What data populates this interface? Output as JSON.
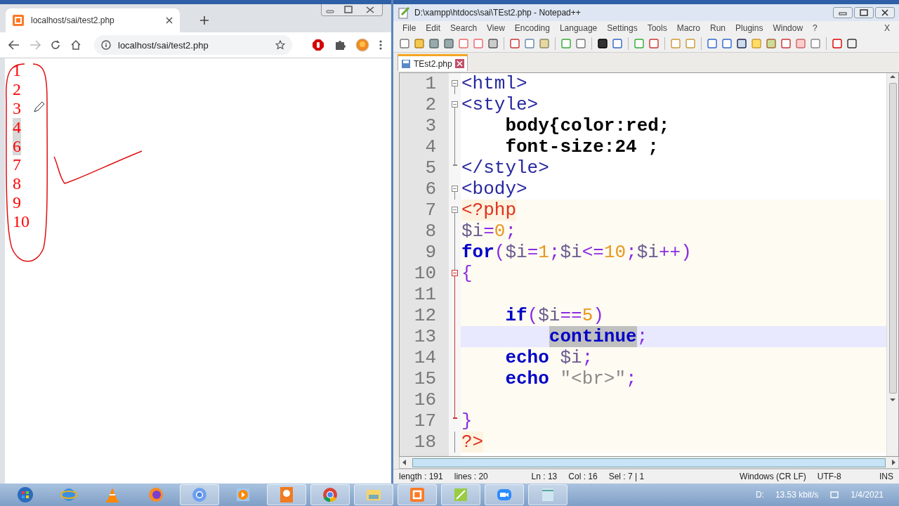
{
  "browser": {
    "tab": {
      "title": "localhost/sai/test2.php"
    },
    "address": "localhost/sai/test2.php",
    "page_lines": [
      {
        "text": "1",
        "selected": false
      },
      {
        "text": "2",
        "selected": false
      },
      {
        "text": "3",
        "selected": false
      },
      {
        "text": "4",
        "selected": true
      },
      {
        "text": "6",
        "selected": true
      },
      {
        "text": "7",
        "selected": false
      },
      {
        "text": "8",
        "selected": false
      },
      {
        "text": "9",
        "selected": false
      },
      {
        "text": "10",
        "selected": false
      }
    ]
  },
  "editor": {
    "title": "D:\\xampp\\htdocs\\sai\\TEst2.php - Notepad++",
    "menu": [
      "File",
      "Edit",
      "Search",
      "View",
      "Encoding",
      "Language",
      "Settings",
      "Tools",
      "Macro",
      "Run",
      "Plugins",
      "Window",
      "?"
    ],
    "menu_close": "X",
    "tab": {
      "label": "TEst2.php"
    },
    "lines": [
      {
        "number": "1",
        "kind": "start",
        "current": false,
        "embedded": false,
        "tokens": [
          {
            "kind": "tag",
            "text": "<html>"
          }
        ]
      },
      {
        "number": "2",
        "kind": "start",
        "current": false,
        "embedded": false,
        "tokens": [
          {
            "kind": "tag",
            "text": "<style>"
          }
        ]
      },
      {
        "number": "3",
        "kind": "line",
        "current": false,
        "embedded": false,
        "tokens": [
          {
            "kind": "css",
            "text": "    body{color:red;"
          }
        ]
      },
      {
        "number": "4",
        "kind": "line",
        "current": false,
        "embedded": false,
        "tokens": [
          {
            "kind": "css",
            "text": "    font-size:24 ;"
          }
        ]
      },
      {
        "number": "5",
        "kind": "end",
        "current": false,
        "embedded": false,
        "tokens": [
          {
            "kind": "tag",
            "text": "</style>"
          }
        ]
      },
      {
        "number": "6",
        "kind": "start",
        "current": false,
        "embedded": false,
        "tokens": [
          {
            "kind": "tag",
            "text": "<body>"
          }
        ]
      },
      {
        "number": "7",
        "kind": "start",
        "current": false,
        "embedded": true,
        "tokens": [
          {
            "kind": "php",
            "text": "<?php"
          }
        ]
      },
      {
        "number": "8",
        "kind": "line",
        "current": false,
        "embedded": true,
        "tokens": [
          {
            "kind": "var",
            "text": "$i"
          },
          {
            "kind": "op",
            "text": "="
          },
          {
            "kind": "num",
            "text": "0"
          },
          {
            "kind": "op",
            "text": ";"
          }
        ]
      },
      {
        "number": "9",
        "kind": "line",
        "current": false,
        "embedded": true,
        "tokens": [
          {
            "kind": "kw",
            "text": "for"
          },
          {
            "kind": "op",
            "text": "("
          },
          {
            "kind": "var",
            "text": "$i"
          },
          {
            "kind": "op",
            "text": "="
          },
          {
            "kind": "num",
            "text": "1"
          },
          {
            "kind": "op",
            "text": ";"
          },
          {
            "kind": "var",
            "text": "$i"
          },
          {
            "kind": "op",
            "text": "<="
          },
          {
            "kind": "num",
            "text": "10"
          },
          {
            "kind": "op",
            "text": ";"
          },
          {
            "kind": "var",
            "text": "$i"
          },
          {
            "kind": "op",
            "text": "++)"
          }
        ]
      },
      {
        "number": "10",
        "kind": "open",
        "current": false,
        "embedded": true,
        "tokens": [
          {
            "kind": "op",
            "text": "{"
          }
        ]
      },
      {
        "number": "11",
        "kind": "inner",
        "current": false,
        "embedded": true
      },
      {
        "number": "12",
        "kind": "inner",
        "current": false,
        "embedded": true,
        "tokens": [
          {
            "kind": "kw",
            "text": "    if"
          },
          {
            "kind": "op",
            "text": "("
          },
          {
            "kind": "var",
            "text": "$i"
          },
          {
            "kind": "op",
            "text": "=="
          },
          {
            "kind": "num",
            "text": "5"
          },
          {
            "kind": "op",
            "text": ")"
          }
        ]
      },
      {
        "number": "13",
        "kind": "inner",
        "current": true,
        "embedded": true,
        "tokens": [
          {
            "kind": "kw",
            "text": "        continue",
            "selected": true
          },
          {
            "kind": "op",
            "text": ";"
          }
        ]
      },
      {
        "number": "14",
        "kind": "inner",
        "current": false,
        "embedded": true,
        "tokens": [
          {
            "kind": "kw",
            "text": "    echo"
          },
          {
            "kind": "var",
            "text": " $i"
          },
          {
            "kind": "op",
            "text": ";"
          }
        ]
      },
      {
        "number": "15",
        "kind": "inner",
        "current": false,
        "embedded": true,
        "tokens": [
          {
            "kind": "kw",
            "text": "    echo"
          },
          {
            "kind": "str",
            "text": " \"<br>\""
          },
          {
            "kind": "op",
            "text": ";"
          }
        ]
      },
      {
        "number": "16",
        "kind": "inner",
        "current": false,
        "embedded": true
      },
      {
        "number": "17",
        "kind": "close",
        "current": false,
        "embedded": true,
        "tokens": [
          {
            "kind": "op",
            "text": "}"
          }
        ]
      },
      {
        "number": "18",
        "kind": "line",
        "current": false,
        "embedded": true,
        "tokens": [
          {
            "kind": "php",
            "text": "?>"
          }
        ]
      }
    ],
    "status": {
      "length": "length : 191",
      "lines": "lines : 20",
      "ln": "Ln : 13",
      "col": "Col : 16",
      "sel": "Sel : 7 | 1",
      "eol": "Windows (CR LF)",
      "encoding": "UTF-8",
      "mode": "INS"
    }
  },
  "taskbar": {
    "drive": "D:",
    "speed": "13.53 kbit/s",
    "date": "1/4/2021"
  }
}
